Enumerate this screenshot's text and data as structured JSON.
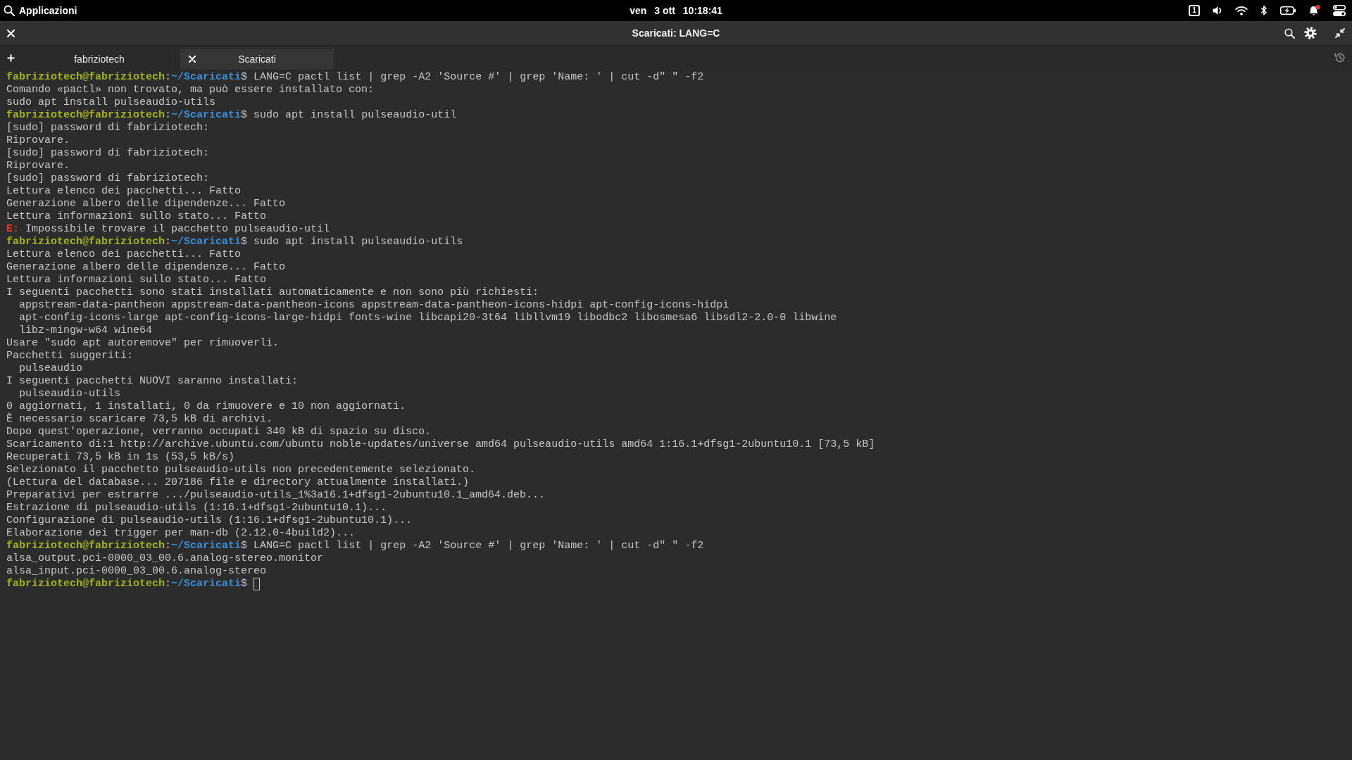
{
  "top_panel": {
    "menu": "Applicazioni",
    "clock": {
      "day": "ven",
      "date": "3 ott",
      "time": "10:18:41"
    },
    "workspace": "1",
    "notifications": {
      "unread": true
    }
  },
  "window": {
    "title": "Scaricati: LANG=C"
  },
  "tabs": [
    {
      "label": "fabriziotech",
      "selected": false
    },
    {
      "label": "Scaricati",
      "selected": true
    }
  ],
  "terminal": {
    "lines": [
      {
        "kind": "prompt",
        "user": "fabriziotech@fabriziotech",
        "separator": ":",
        "path": "~/Scaricati",
        "sigil": "$",
        "command": "LANG=C pactl list | grep -A2 'Source #' | grep 'Name: ' | cut -d\" \" -f2",
        "cursor": false
      },
      {
        "kind": "output",
        "text": "Comando «pactl» non trovato, ma può essere installato con:"
      },
      {
        "kind": "output",
        "text": "sudo apt install pulseaudio-utils"
      },
      {
        "kind": "prompt",
        "user": "fabriziotech@fabriziotech",
        "separator": ":",
        "path": "~/Scaricati",
        "sigil": "$",
        "command": "sudo apt install pulseaudio-util",
        "cursor": false
      },
      {
        "kind": "output",
        "text": "[sudo] password di fabriziotech:"
      },
      {
        "kind": "output",
        "text": "Riprovare."
      },
      {
        "kind": "output",
        "text": "[sudo] password di fabriziotech:"
      },
      {
        "kind": "output",
        "text": "Riprovare."
      },
      {
        "kind": "output",
        "text": "[sudo] password di fabriziotech:"
      },
      {
        "kind": "output",
        "text": "Lettura elenco dei pacchetti... Fatto"
      },
      {
        "kind": "output",
        "text": "Generazione albero delle dipendenze... Fatto"
      },
      {
        "kind": "output",
        "text": "Lettura informazioni sullo stato... Fatto"
      },
      {
        "kind": "error",
        "label": "E:",
        "text": "Impossibile trovare il pacchetto pulseaudio-util"
      },
      {
        "kind": "prompt",
        "user": "fabriziotech@fabriziotech",
        "separator": ":",
        "path": "~/Scaricati",
        "sigil": "$",
        "command": "sudo apt install pulseaudio-utils",
        "cursor": false
      },
      {
        "kind": "output",
        "text": "Lettura elenco dei pacchetti... Fatto"
      },
      {
        "kind": "output",
        "text": "Generazione albero delle dipendenze... Fatto"
      },
      {
        "kind": "output",
        "text": "Lettura informazioni sullo stato... Fatto"
      },
      {
        "kind": "output",
        "text": "I seguenti pacchetti sono stati installati automaticamente e non sono più richiesti:",
        "children": [
          {
            "kind": "output",
            "text": "appstream-data-pantheon appstream-data-pantheon-icons appstream-data-pantheon-icons-hidpi apt-config-icons-hidpi"
          },
          {
            "kind": "output",
            "text": "apt-config-icons-large apt-config-icons-large-hidpi fonts-wine libcapi20-3t64 libllvm19 libodbc2 libosmesa6 libsdl2-2.0-0 libwine"
          },
          {
            "kind": "output",
            "text": "libz-mingw-w64 wine64"
          }
        ]
      },
      {
        "kind": "output",
        "text": "Usare \"sudo apt autoremove\" per rimuoverli."
      },
      {
        "kind": "output",
        "text": "Pacchetti suggeriti:",
        "children": [
          {
            "kind": "output",
            "text": "pulseaudio"
          }
        ]
      },
      {
        "kind": "output",
        "text": "I seguenti pacchetti NUOVI saranno installati:",
        "children": [
          {
            "kind": "output",
            "text": "pulseaudio-utils"
          }
        ]
      },
      {
        "kind": "output",
        "text": "0 aggiornati, 1 installati, 0 da rimuovere e 10 non aggiornati."
      },
      {
        "kind": "output",
        "text": "È necessario scaricare 73,5 kB di archivi."
      },
      {
        "kind": "output",
        "text": "Dopo quest'operazione, verranno occupati 340 kB di spazio su disco."
      },
      {
        "kind": "output",
        "text": "Scaricamento di:1 http://archive.ubuntu.com/ubuntu noble-updates/universe amd64 pulseaudio-utils amd64 1:16.1+dfsg1-2ubuntu10.1 [73,5 kB]"
      },
      {
        "kind": "output",
        "text": "Recuperati 73,5 kB in 1s (53,5 kB/s)"
      },
      {
        "kind": "output",
        "text": "Selezionato il pacchetto pulseaudio-utils non precedentemente selezionato."
      },
      {
        "kind": "output",
        "text": "(Lettura del database... 207186 file e directory attualmente installati.)"
      },
      {
        "kind": "output",
        "text": "Preparativi per estrarre .../pulseaudio-utils_1%3a16.1+dfsg1-2ubuntu10.1_amd64.deb..."
      },
      {
        "kind": "output",
        "text": "Estrazione di pulseaudio-utils (1:16.1+dfsg1-2ubuntu10.1)..."
      },
      {
        "kind": "output",
        "text": "Configurazione di pulseaudio-utils (1:16.1+dfsg1-2ubuntu10.1)..."
      },
      {
        "kind": "output",
        "text": "Elaborazione dei trigger per man-db (2.12.0-4build2)..."
      },
      {
        "kind": "prompt",
        "user": "fabriziotech@fabriziotech",
        "separator": ":",
        "path": "~/Scaricati",
        "sigil": "$",
        "command": "LANG=C pactl list | grep -A2 'Source #' | grep 'Name: ' | cut -d\" \" -f2",
        "cursor": false
      },
      {
        "kind": "output",
        "text": "alsa_output.pci-0000_03_00.6.analog-stereo.monitor"
      },
      {
        "kind": "output",
        "text": "alsa_input.pci-0000_03_00.6.analog-stereo"
      },
      {
        "kind": "prompt",
        "user": "fabriziotech@fabriziotech",
        "separator": ":",
        "path": "~/Scaricati",
        "sigil": "$",
        "cursor": true
      }
    ]
  }
}
